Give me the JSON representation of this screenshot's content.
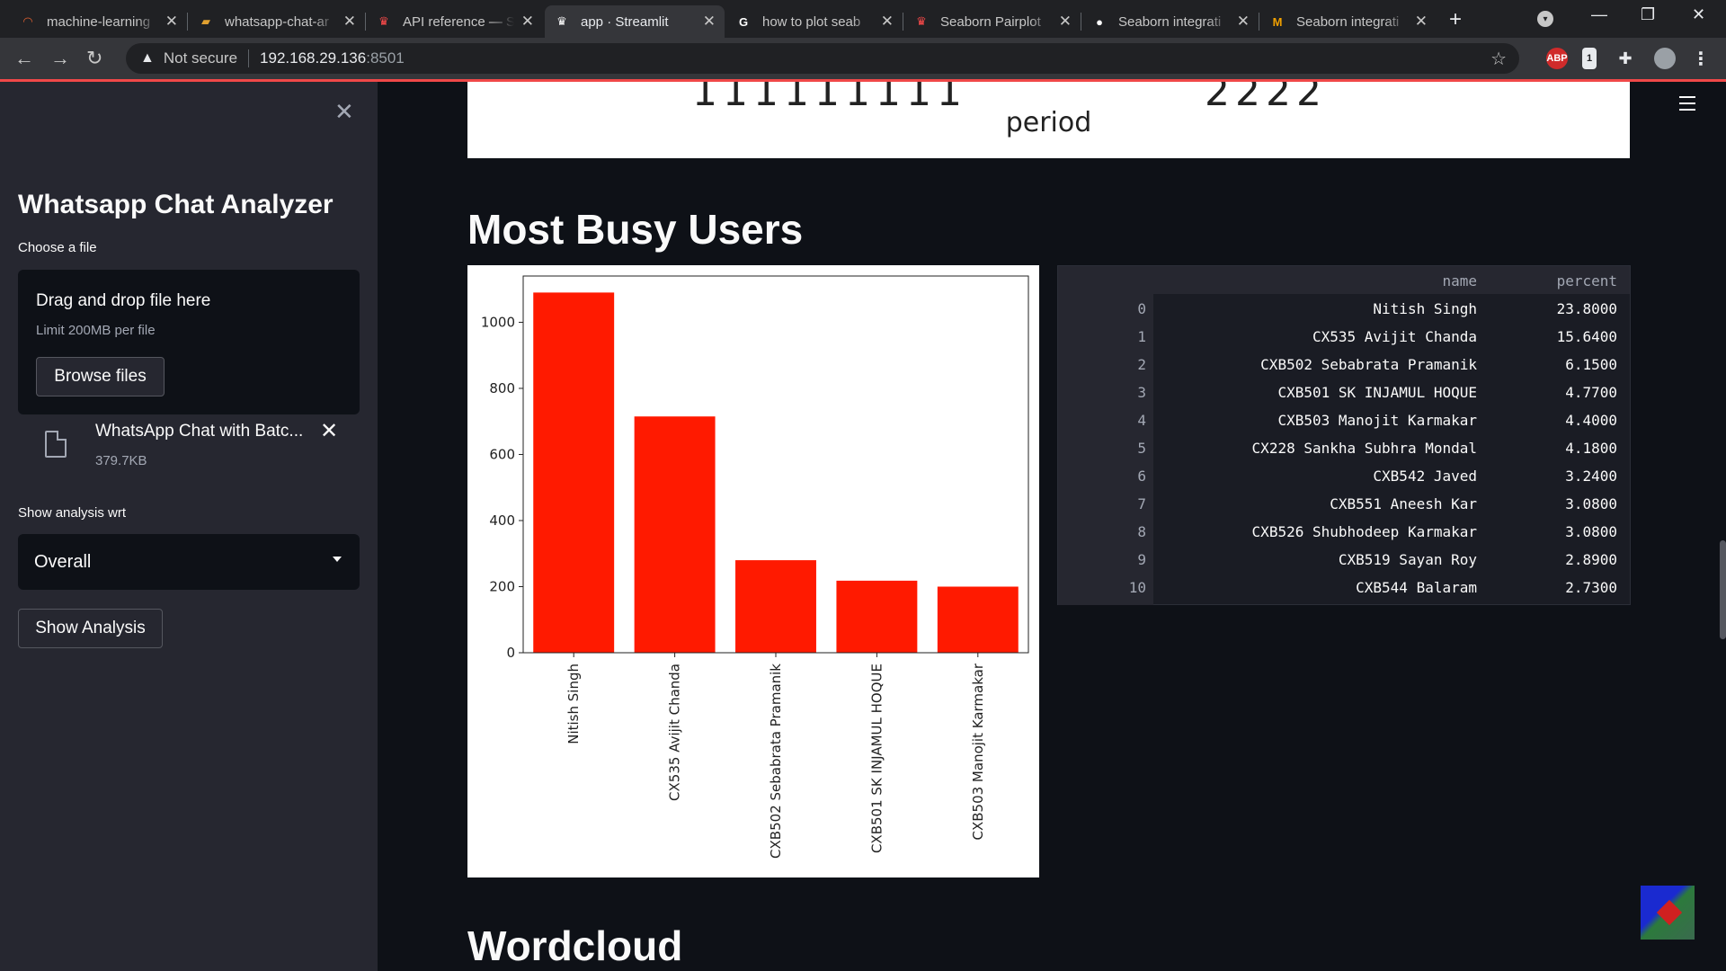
{
  "browser": {
    "tabs": [
      {
        "title": "machine-learning",
        "icon": "loading-spinner-icon",
        "color": "#e06030",
        "left": 12,
        "width": 196,
        "active": false
      },
      {
        "title": "whatsapp-chat-ar",
        "icon": "book-icon",
        "color": "#e0a030",
        "left": 210,
        "width": 196,
        "active": false
      },
      {
        "title": "API reference — S",
        "icon": "streamlit-crown-icon",
        "color": "#ff4b4b",
        "left": 408,
        "width": 196,
        "active": false
      },
      {
        "title": "app · Streamlit",
        "icon": "streamlit-crown-icon",
        "color": "#ffffff",
        "left": 606,
        "width": 200,
        "active": true
      },
      {
        "title": "how to plot seab",
        "icon": "google-icon",
        "color": "#ffffff",
        "left": 808,
        "width": 196,
        "active": false
      },
      {
        "title": "Seaborn Pairplot",
        "icon": "streamlit-crown-icon",
        "color": "#ff4b4b",
        "left": 1006,
        "width": 196,
        "active": false
      },
      {
        "title": "Seaborn integrati",
        "icon": "github-icon",
        "color": "#ffffff",
        "left": 1204,
        "width": 196,
        "active": false
      },
      {
        "title": "Seaborn integrati",
        "icon": "medium-icon",
        "color": "#f0a000",
        "left": 1402,
        "width": 196,
        "active": false
      }
    ],
    "not_secure": "Not secure",
    "url_host": "192.168.29.136",
    "url_port": ":8501"
  },
  "sidebar": {
    "title": "Whatsapp Chat Analyzer",
    "choose_file_label": "Choose a file",
    "dropzone_text": "Drag and drop file here",
    "dropzone_limit": "Limit 200MB per file",
    "browse_label": "Browse files",
    "file_name": "WhatsApp Chat with Batc...",
    "file_size": "379.7KB",
    "analysis_label": "Show analysis wrt",
    "analysis_value": "Overall",
    "show_button": "Show Analysis"
  },
  "main": {
    "prev_plot_xlabel": "period",
    "busy_heading": "Most Busy Users",
    "wordcloud_heading": "Wordcloud"
  },
  "busy_table": {
    "columns": [
      "",
      "name",
      "percent"
    ],
    "rows": [
      [
        "0",
        "Nitish Singh",
        "23.8000"
      ],
      [
        "1",
        "CX535 Avijit Chanda",
        "15.6400"
      ],
      [
        "2",
        "CXB502 Sebabrata Pramanik",
        "6.1500"
      ],
      [
        "3",
        "CXB501 SK INJAMUL HOQUE",
        "4.7700"
      ],
      [
        "4",
        "CXB503 Manojit Karmakar",
        "4.4000"
      ],
      [
        "5",
        "CX228 Sankha Subhra Mondal",
        "4.1800"
      ],
      [
        "6",
        "CXB542 Javed",
        "3.2400"
      ],
      [
        "7",
        "CXB551 Aneesh Kar",
        "3.0800"
      ],
      [
        "8",
        "CXB526 Shubhodeep Karmakar",
        "3.0800"
      ],
      [
        "9",
        "CXB519 Sayan Roy",
        "2.8900"
      ],
      [
        "10",
        "CXB544 Balaram",
        "2.7300"
      ]
    ]
  },
  "chart_data": {
    "type": "bar",
    "categories": [
      "Nitish Singh",
      "CX535 Avijit Chanda",
      "CXB502 Sebabrata Pramanik",
      "CXB501 SK INJAMUL HOQUE",
      "CXB503 Manojit Karmakar"
    ],
    "values": [
      1090,
      715,
      280,
      218,
      200
    ],
    "ylim": [
      0,
      1140
    ],
    "yticks": [
      0,
      200,
      400,
      600,
      800,
      1000
    ],
    "bar_color": "#ff1a00",
    "xlabel": "",
    "ylabel": "",
    "title": ""
  }
}
